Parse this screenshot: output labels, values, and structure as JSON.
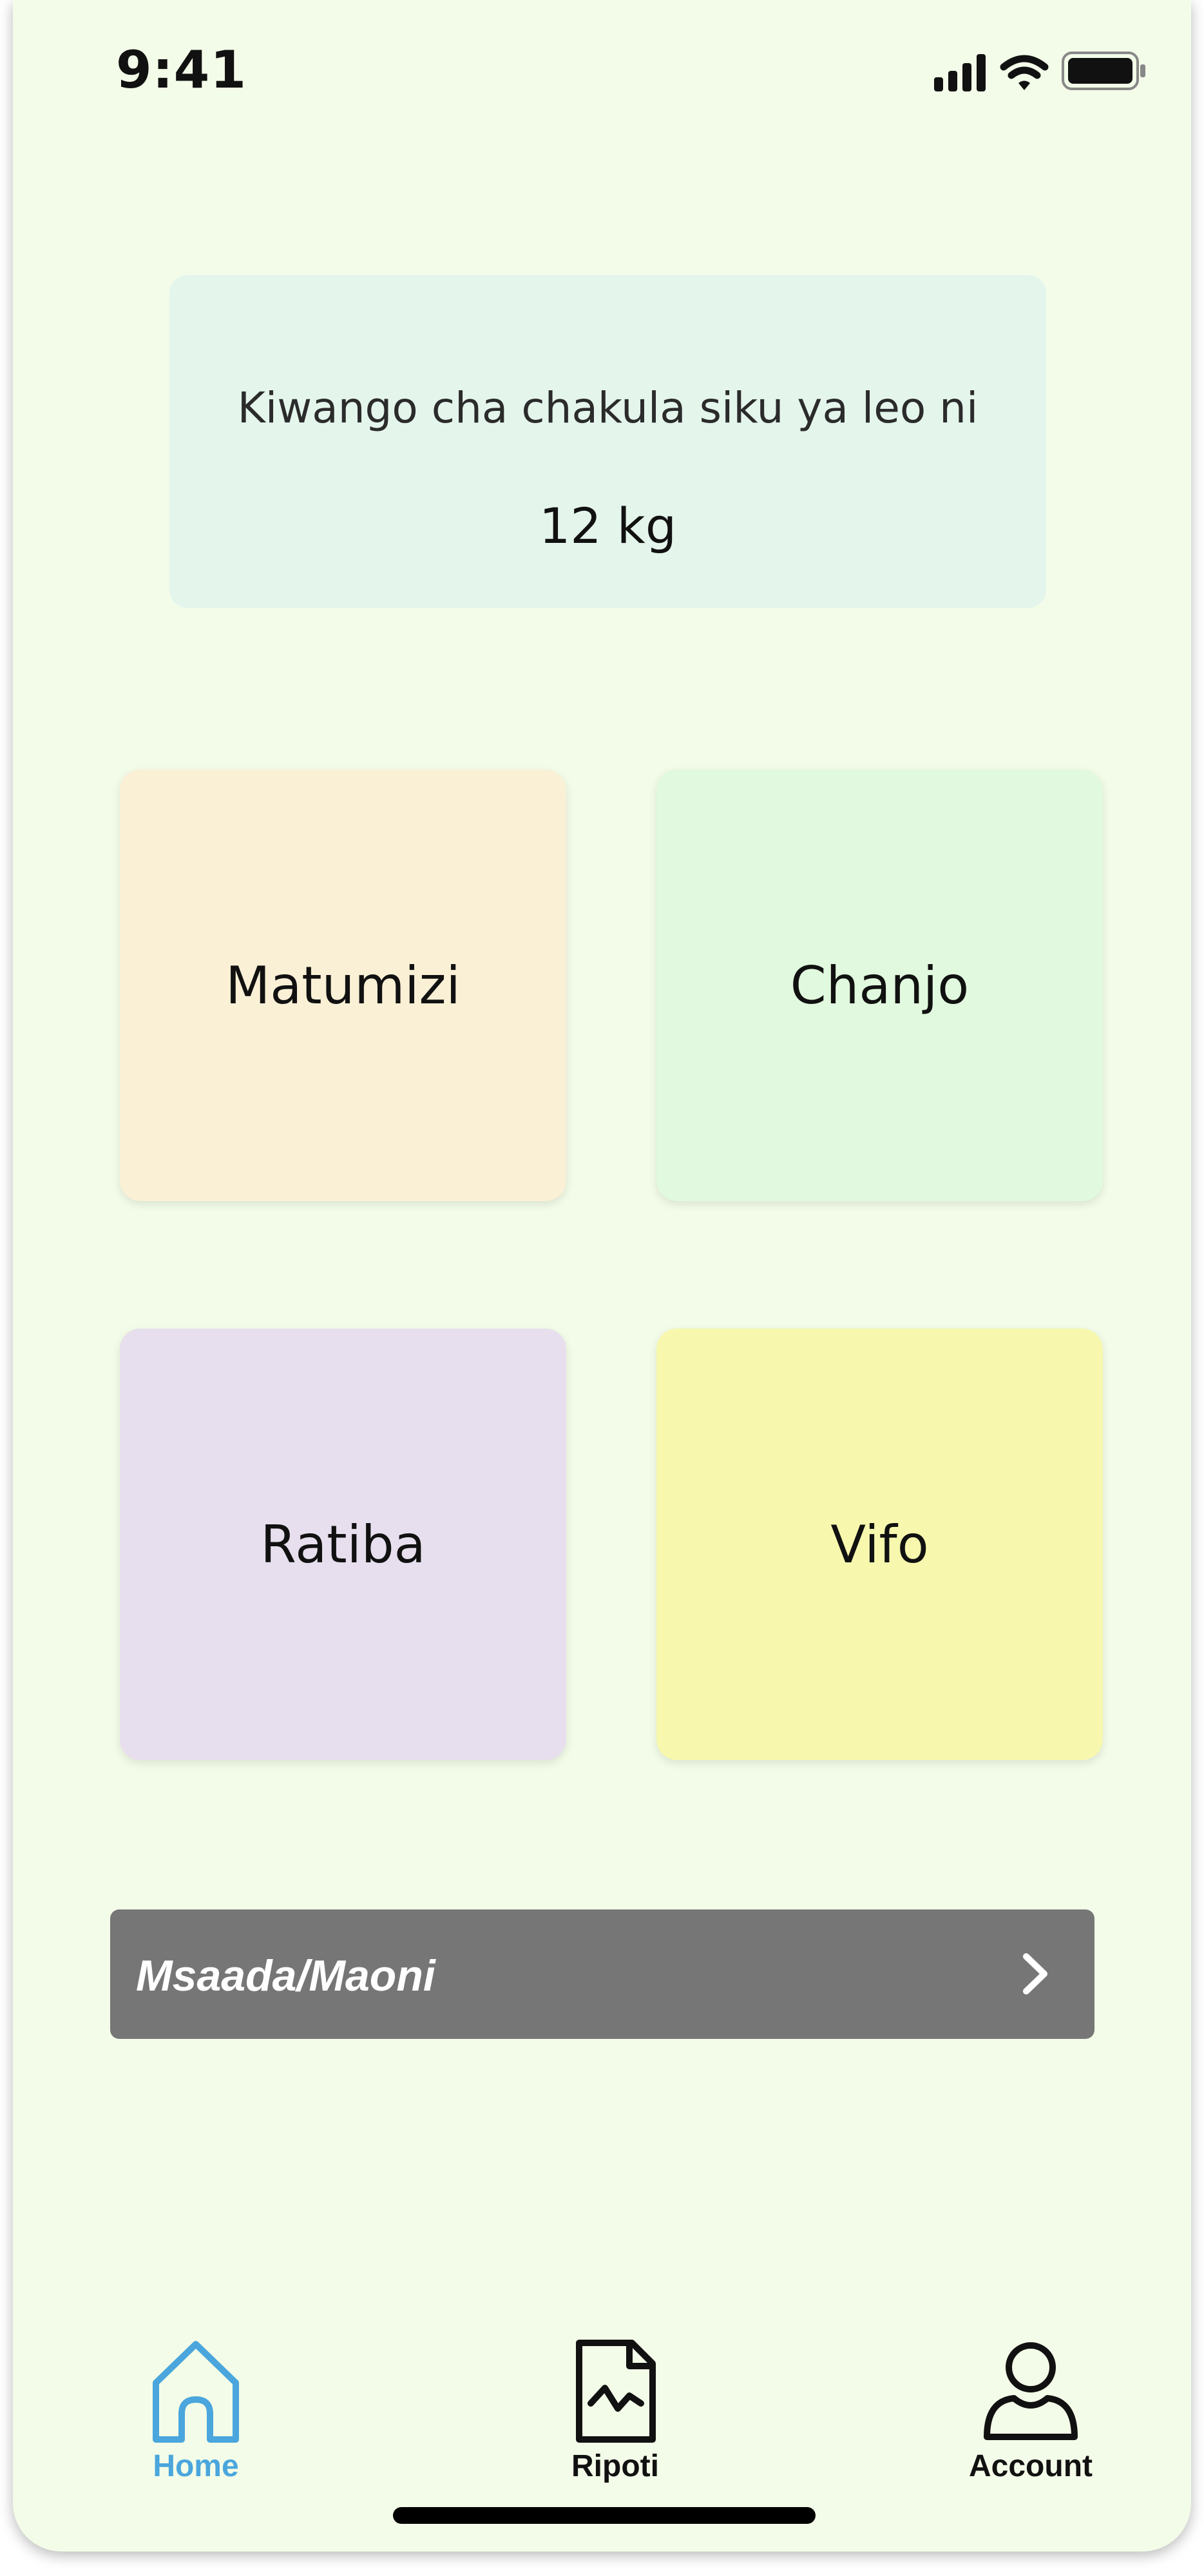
{
  "status_bar": {
    "time": "9:41",
    "icons": [
      "cellular-signal-icon",
      "wifi-icon",
      "battery-icon"
    ]
  },
  "food_card": {
    "caption": "Kiwango cha chakula siku ya leo ni",
    "amount": "12 kg"
  },
  "tiles": [
    {
      "label": "Matumizi",
      "color": "#f9f0d6"
    },
    {
      "label": "Chanjo",
      "color": "#e1f9de"
    },
    {
      "label": "Ratiba",
      "color": "#e7dfed"
    },
    {
      "label": "Vifo",
      "color": "#f7f8ae"
    }
  ],
  "help": {
    "label": "Msaada/Maoni",
    "icon": "chevron-right-icon"
  },
  "nav": {
    "items": [
      {
        "label": "Home",
        "icon": "home-icon",
        "active": true
      },
      {
        "label": "Ripoti",
        "icon": "report-icon",
        "active": false
      },
      {
        "label": "Account",
        "icon": "user-icon",
        "active": false
      }
    ]
  },
  "colors": {
    "background": "#f3fce8",
    "active_nav": "#4aa6dc",
    "help_bar": "#767676"
  }
}
